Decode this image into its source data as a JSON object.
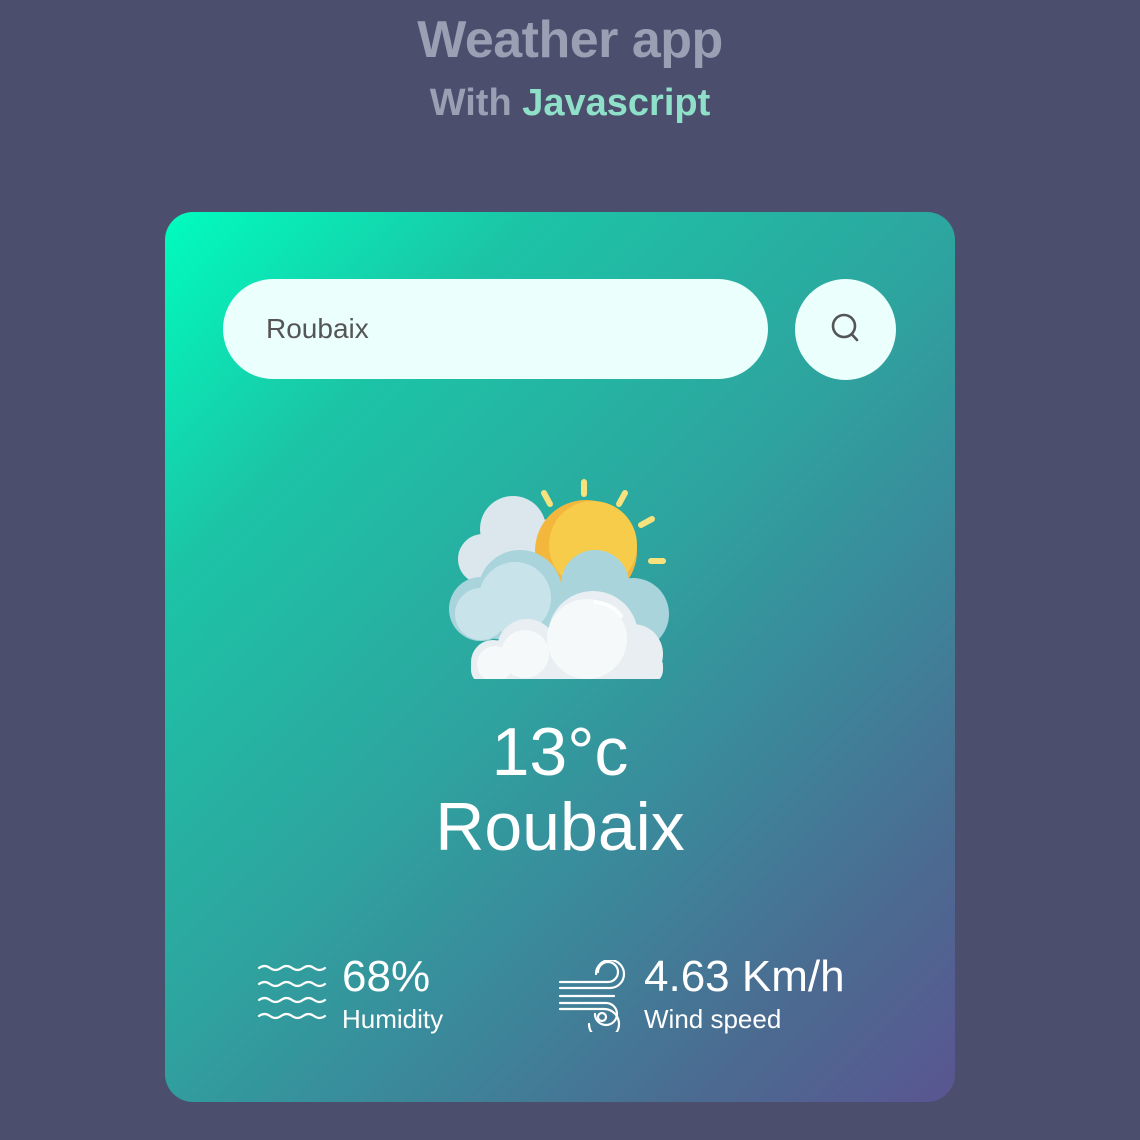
{
  "header": {
    "title": "Weather app",
    "subtitle_prefix": "With",
    "subtitle_accent": "Javascript"
  },
  "search": {
    "value": "Roubaix",
    "placeholder": "",
    "button_icon": "search-icon"
  },
  "weather": {
    "icon": "partly-cloudy-sun-icon",
    "temperature": "13°c",
    "city": "Roubaix"
  },
  "details": {
    "humidity": {
      "icon": "humidity-waves-icon",
      "value": "68%",
      "label": "Humidity"
    },
    "wind": {
      "icon": "wind-icon",
      "value": "4.63 Km/h",
      "label": "Wind speed"
    }
  },
  "colors": {
    "background": "#4b4e6d",
    "header_text": "#9aa0b3",
    "accent": "#8fe0c8",
    "card_gradient_start": "#00fdbf",
    "card_gradient_end": "#5a5591",
    "input_background": "#ebfffc"
  }
}
